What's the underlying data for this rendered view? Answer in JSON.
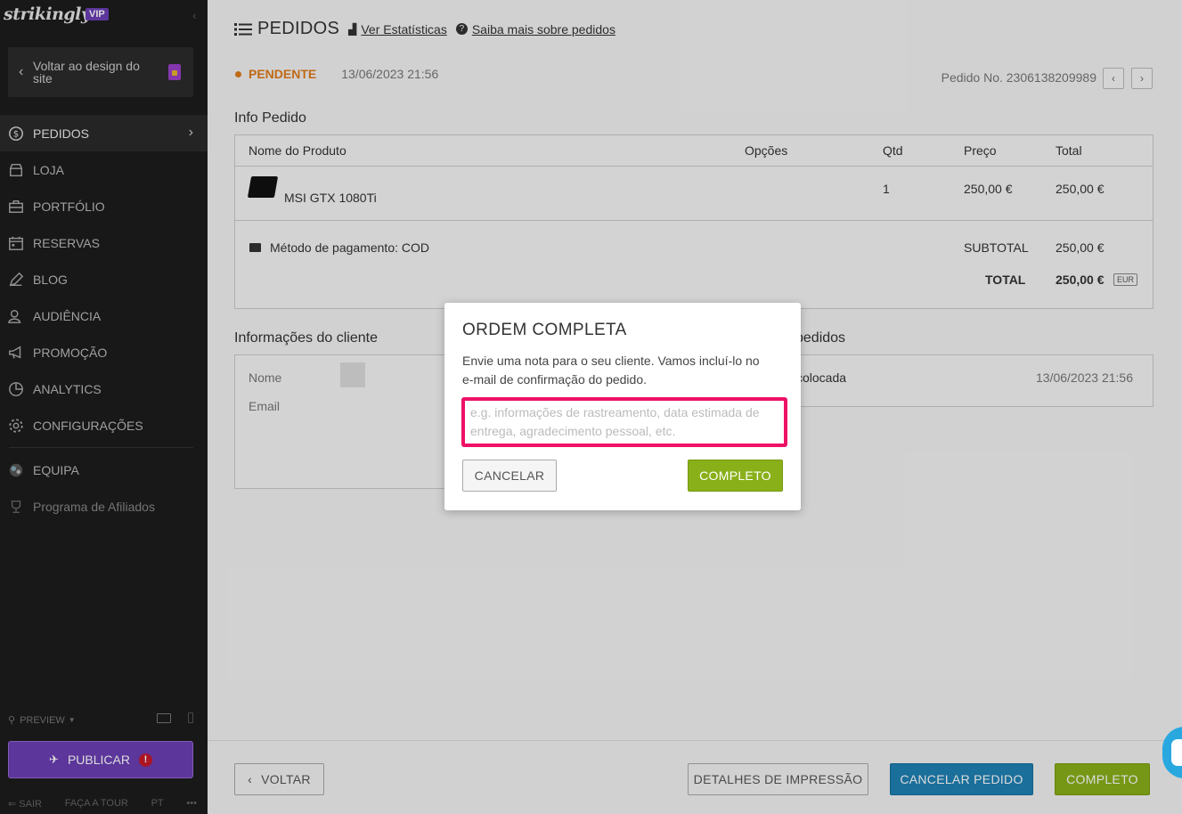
{
  "sidebar": {
    "brand": "strikingly",
    "vip": "VIP",
    "back_design": "Voltar ao design do site",
    "nav": [
      {
        "label": "PEDIDOS",
        "icon": "dollar-icon"
      },
      {
        "label": "LOJA",
        "icon": "store-icon"
      },
      {
        "label": "PORTFÓLIO",
        "icon": "briefcase-icon"
      },
      {
        "label": "RESERVAS",
        "icon": "calendar-icon"
      },
      {
        "label": "BLOG",
        "icon": "pen-icon"
      },
      {
        "label": "AUDIÊNCIA",
        "icon": "people-icon"
      },
      {
        "label": "PROMOÇÃO",
        "icon": "megaphone-icon"
      },
      {
        "label": "ANALYTICS",
        "icon": "pie-chart-icon"
      },
      {
        "label": "CONFIGURAÇÕES",
        "icon": "gear-icon"
      }
    ],
    "team": "EQUIPA",
    "affiliates": "Programa de Afiliados",
    "preview": "PREVIEW",
    "publish": "PUBLICAR",
    "publish_alert": "!",
    "footer": {
      "exit": "SAIR",
      "tour": "FAÇA A TOUR",
      "lang": "PT",
      "more": "•••"
    }
  },
  "header": {
    "title": "PEDIDOS",
    "stats_link": "Ver Estatísticas",
    "learn_link": "Saiba mais sobre pedidos"
  },
  "order": {
    "status": "PENDENTE",
    "date": "13/06/2023 21:56",
    "number": "Pedido No. 2306138209989"
  },
  "info": {
    "title": "Info Pedido",
    "columns": [
      "Nome do Produto",
      "Opções",
      "Qtd",
      "Preço",
      "Total"
    ],
    "item": {
      "name": "MSI GTX 1080Ti",
      "qty": "1",
      "price": "250,00 €",
      "total": "250,00 €"
    },
    "payment": "Método de pagamento: COD",
    "subtotal_label": "SUBTOTAL",
    "subtotal": "250,00 €",
    "total_label": "TOTAL",
    "total": "250,00 €",
    "currency": "EUR"
  },
  "customer": {
    "title": "Informações do cliente",
    "name_label": "Nome",
    "email_label": "Email"
  },
  "history": {
    "title": "pedidos",
    "event": "colocada",
    "date": "13/06/2023 21:56"
  },
  "actions": {
    "back": "VOLTAR",
    "print": "DETALHES DE IMPRESSÃO",
    "cancel_order": "CANCELAR PEDIDO",
    "complete": "COMPLETO"
  },
  "modal": {
    "title": "ORDEM COMPLETA",
    "desc": "Envie uma nota para o seu cliente. Vamos incluí-lo no e-mail de confirmação do pedido.",
    "placeholder": "e.g. informações de rastreamento, data estimada de entrega, agradecimento pessoal, etc.",
    "cancel": "CANCELAR",
    "complete": "COMPLETO"
  },
  "colors": {
    "sidebar": "#1c1c1c",
    "accent_purple": "#6c3fb5",
    "status_orange": "#e07b1a",
    "green": "#8ab019",
    "blue": "#1f82b5",
    "highlight": "#ee1166"
  }
}
